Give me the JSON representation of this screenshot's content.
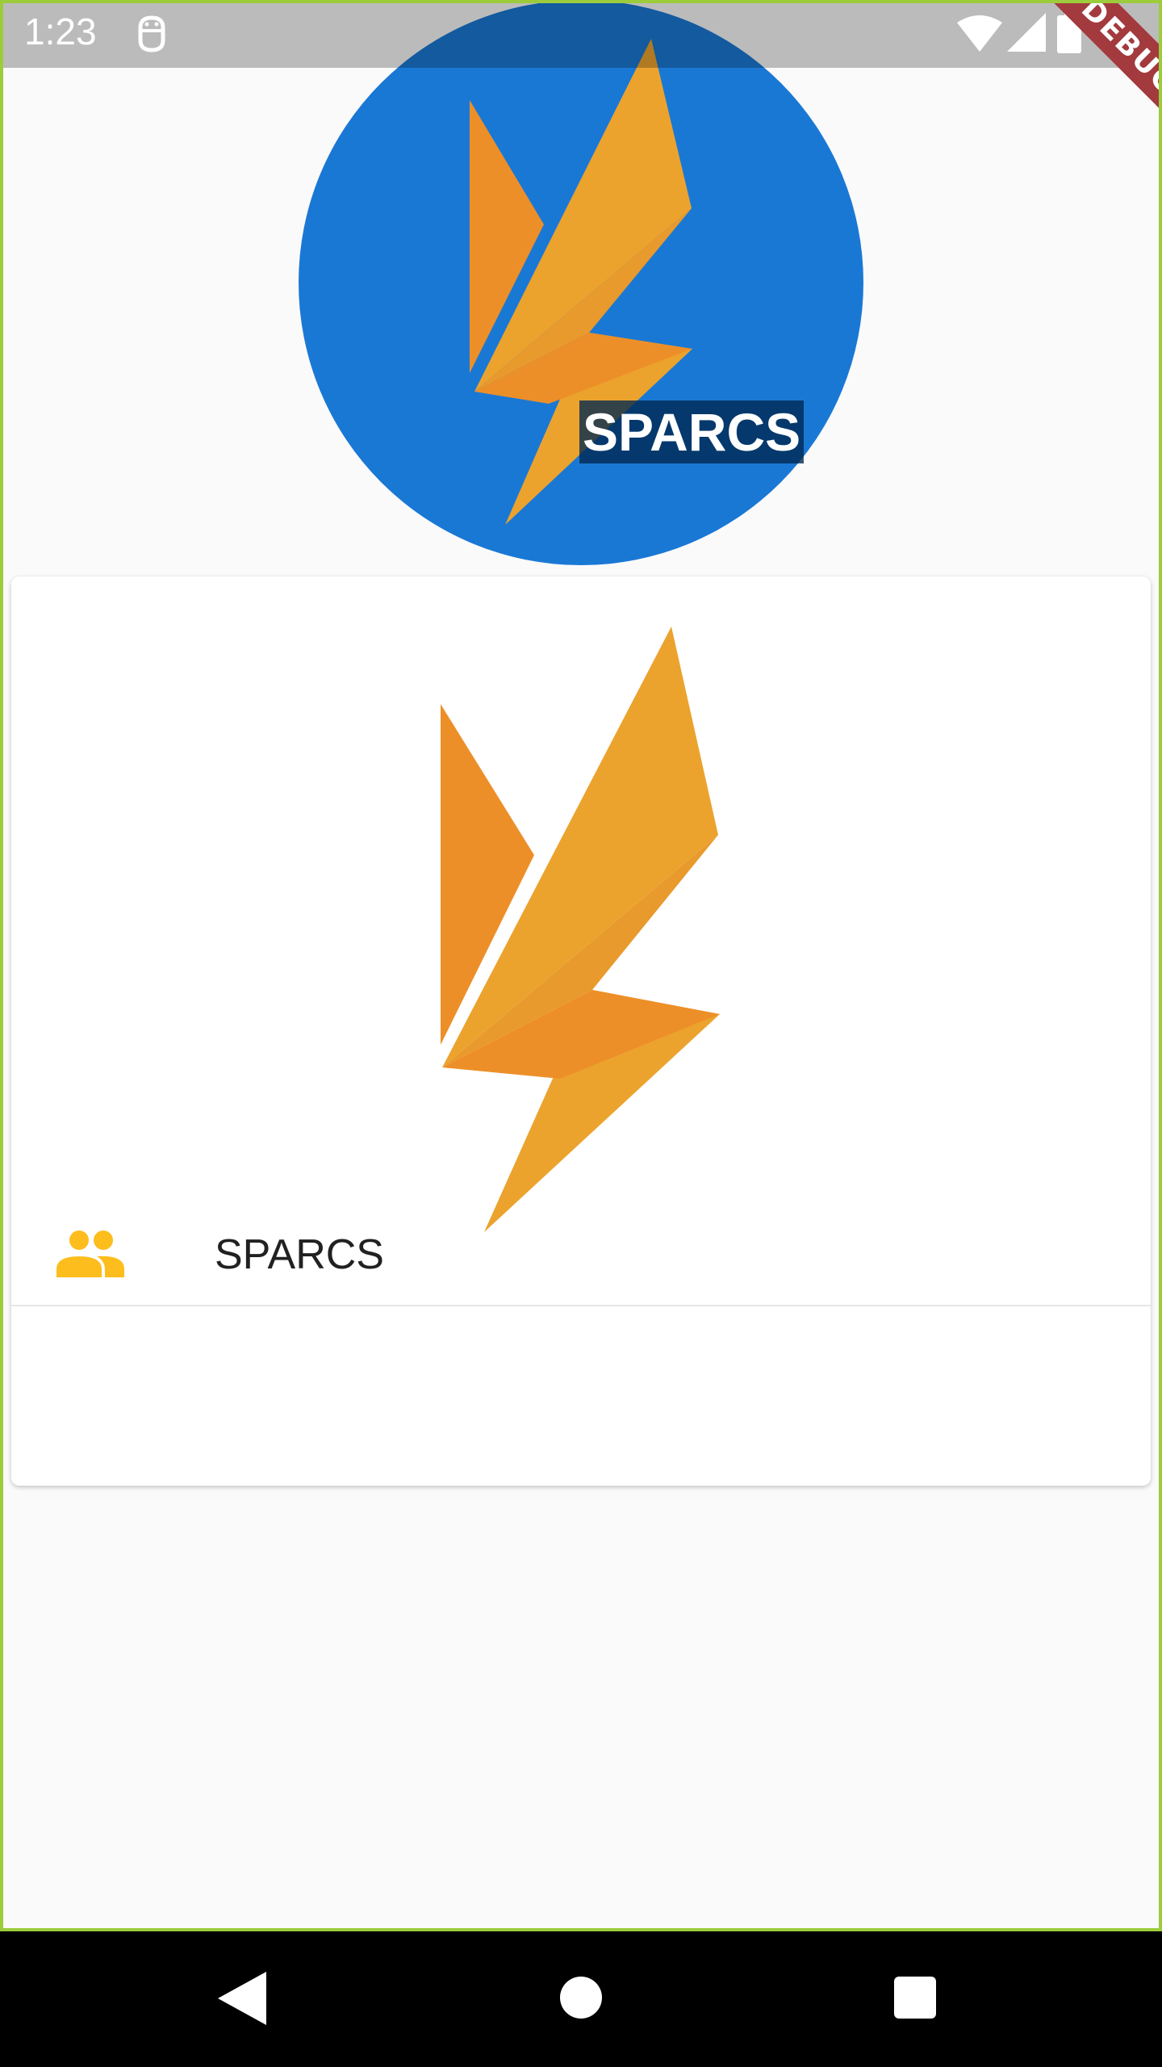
{
  "status_bar": {
    "time": "1:23",
    "icons": [
      "notification-icon",
      "wifi-icon",
      "signal-icon",
      "battery-icon"
    ]
  },
  "debug_banner": {
    "label": "DEBUG"
  },
  "header": {
    "avatar_label": "SPARCS",
    "avatar_color": "#1a78d5"
  },
  "card": {
    "title": "SPARCS",
    "leading_icon": "group-icon",
    "icon_color": "#fdbd1c"
  },
  "colors": {
    "logo_primary": "#eba32e",
    "logo_secondary": "#ed8f28",
    "background": "#fafafa"
  },
  "nav_bar": {
    "buttons": [
      "back-button",
      "home-button",
      "recents-button"
    ]
  }
}
